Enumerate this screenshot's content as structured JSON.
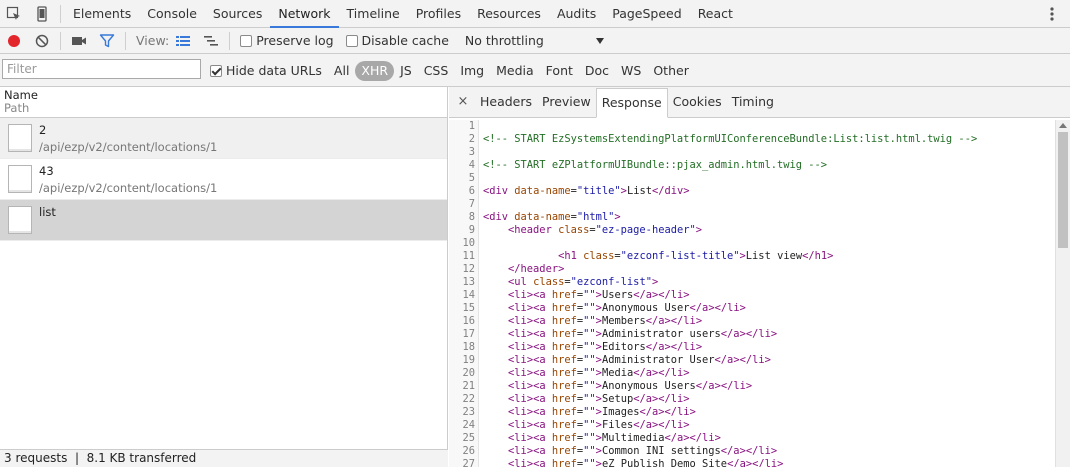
{
  "tabs": [
    {
      "label": "Elements"
    },
    {
      "label": "Console"
    },
    {
      "label": "Sources"
    },
    {
      "label": "Network",
      "active": true
    },
    {
      "label": "Timeline"
    },
    {
      "label": "Profiles"
    },
    {
      "label": "Resources"
    },
    {
      "label": "Audits"
    },
    {
      "label": "PageSpeed"
    },
    {
      "label": "React"
    }
  ],
  "toolbar": {
    "view_label": "View:",
    "preserve_log": "Preserve log",
    "disable_cache": "Disable cache",
    "throttling": "No throttling"
  },
  "filterbar": {
    "placeholder": "Filter",
    "hide_data_urls": "Hide data URLs",
    "types": [
      "All",
      "XHR",
      "JS",
      "CSS",
      "Img",
      "Media",
      "Font",
      "Doc",
      "WS",
      "Other"
    ],
    "active_type": "XHR"
  },
  "columns": {
    "name": "Name",
    "path": "Path"
  },
  "requests": [
    {
      "name": "2",
      "path": "/api/ezp/v2/content/locations/1"
    },
    {
      "name": "43",
      "path": "/api/ezp/v2/content/locations/1"
    },
    {
      "name": "list",
      "path": "",
      "selected": true
    }
  ],
  "status": "3 requests  |  8.1 KB transferred",
  "detail_tabs": [
    "Headers",
    "Preview",
    "Response",
    "Cookies",
    "Timing"
  ],
  "active_detail_tab": "Response",
  "close_symbol": "×",
  "response_lines": [
    "",
    "<!-- START EzSystemsExtendingPlatformUIConferenceBundle:List:list.html.twig -->",
    "",
    "<!-- START eZPlatformUIBundle::pjax_admin.html.twig -->",
    "",
    "<div data-name=\"title\">List</div>",
    "",
    "<div data-name=\"html\">",
    "    <header class=\"ez-page-header\">",
    "",
    "            <h1 class=\"ezconf-list-title\">List view</h1>",
    "    </header>",
    "    <ul class=\"ezconf-list\">",
    "    <li><a href=\"\">Users</a></li>",
    "    <li><a href=\"\">Anonymous User</a></li>",
    "    <li><a href=\"\">Members</a></li>",
    "    <li><a href=\"\">Administrator users</a></li>",
    "    <li><a href=\"\">Editors</a></li>",
    "    <li><a href=\"\">Administrator User</a></li>",
    "    <li><a href=\"\">Media</a></li>",
    "    <li><a href=\"\">Anonymous Users</a></li>",
    "    <li><a href=\"\">Setup</a></li>",
    "    <li><a href=\"\">Images</a></li>",
    "    <li><a href=\"\">Files</a></li>",
    "    <li><a href=\"\">Multimedia</a></li>",
    "    <li><a href=\"\">Common INI settings</a></li>",
    "    <li><a href=\"\">eZ Publish Demo Site</a></li>"
  ],
  "colors": {
    "accent": "#3879d9",
    "record": "#e3252c",
    "comment": "#236e25",
    "tag": "#881280",
    "attr": "#994500",
    "value": "#1a1aa6"
  }
}
